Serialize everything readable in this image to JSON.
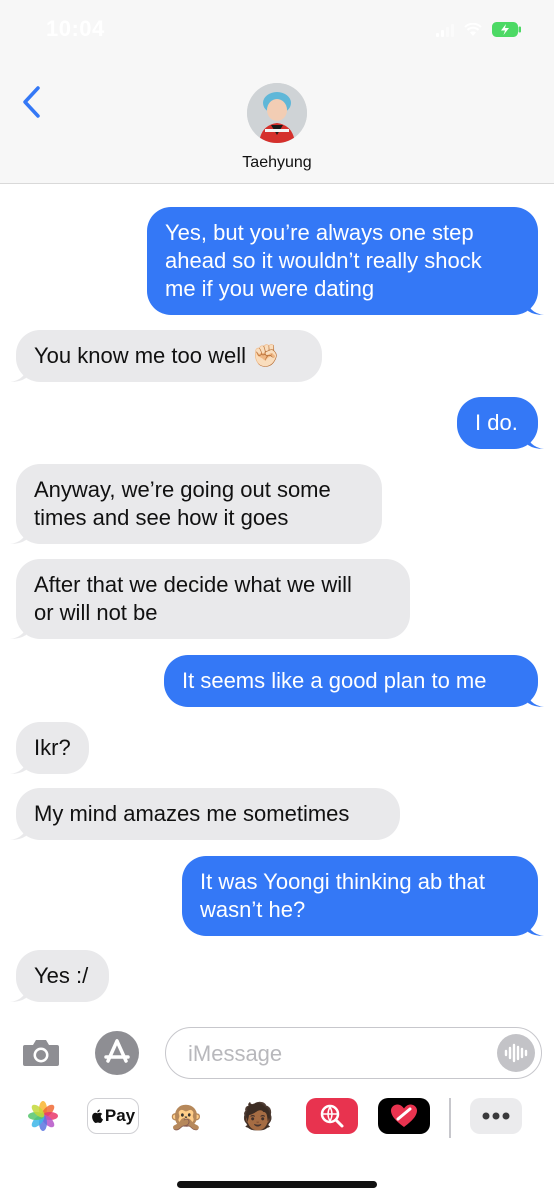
{
  "status_bar": {
    "time": "10:04"
  },
  "header": {
    "back_icon": "chevron-left-icon",
    "contact_name": "Taehyung"
  },
  "messages": [
    {
      "sender": "me",
      "text_lines": [
        "Yes, but you’re always one step",
        "ahead so it wouldn’t really shock",
        "me if you were dating"
      ]
    },
    {
      "sender": "contact",
      "text_lines": [
        "You know me too well ✊🏻"
      ]
    },
    {
      "sender": "me",
      "text_lines": [
        "I do."
      ]
    },
    {
      "sender": "contact",
      "text_lines": [
        "Anyway, we’re going out some",
        "times and see how it goes"
      ]
    },
    {
      "sender": "contact",
      "text_lines": [
        "After that we decide what we will",
        "or will not be"
      ]
    },
    {
      "sender": "me",
      "text_lines": [
        "It seems like a good plan to me"
      ]
    },
    {
      "sender": "contact",
      "text_lines": [
        "Ikr?"
      ]
    },
    {
      "sender": "contact",
      "text_lines": [
        "My mind amazes me sometimes"
      ]
    },
    {
      "sender": "me",
      "text_lines": [
        "It was Yoongi thinking ab that",
        "wasn’t he?"
      ]
    },
    {
      "sender": "contact",
      "text_lines": [
        "Yes :/"
      ]
    }
  ],
  "input_bar": {
    "camera_icon": "camera-icon",
    "appstore_icon": "app-store-icon",
    "placeholder": "iMessage",
    "audio_icon": "audio-waveform-icon"
  },
  "app_drawer": {
    "items": [
      {
        "name": "photos-icon"
      },
      {
        "name": "apple-pay-icon",
        "label": "Pay"
      },
      {
        "name": "animoji-monkey-icon",
        "label": "🙊"
      },
      {
        "name": "memoji-icon",
        "label": "🧑🏾"
      },
      {
        "name": "web-images-search-icon"
      },
      {
        "name": "digital-touch-icon"
      },
      {
        "name": "more-apps-icon"
      }
    ]
  },
  "colors": {
    "outgoing_bubble": "#3478f6",
    "incoming_bubble": "#e9e9eb",
    "accent": "#3478f6",
    "battery": "#4cd964"
  }
}
